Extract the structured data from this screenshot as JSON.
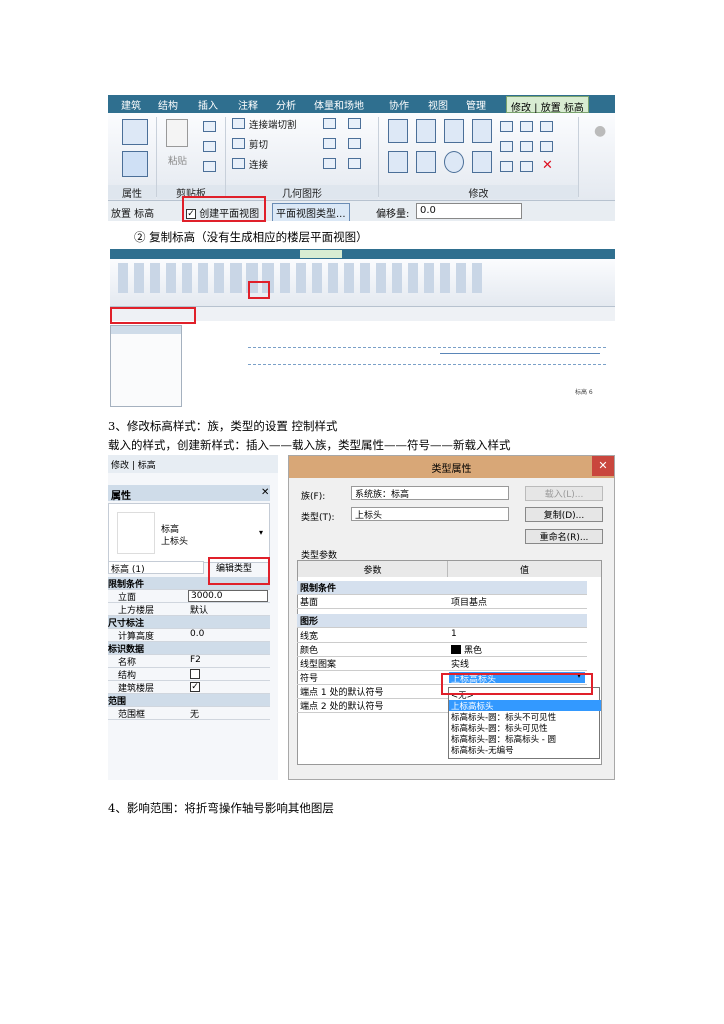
{
  "ribbon": {
    "tabs": [
      "建筑",
      "结构",
      "插入",
      "注释",
      "分析",
      "体量和场地",
      "协作",
      "视图",
      "管理"
    ],
    "active_tab": "修改 | 放置 标高",
    "buttons": {
      "cut_join": "连接端切割",
      "cut": "剪切",
      "join": "连接",
      "paste": "粘贴"
    },
    "groups": [
      "属性",
      "剪贴板",
      "几何图形",
      "修改"
    ]
  },
  "options_bar": {
    "context": "放置 标高",
    "create_plan_view_label": "创建平面视图",
    "create_plan_view_checked": true,
    "plan_view_types_button": "平面视图类型...",
    "offset_label": "偏移量:",
    "offset_value": "0.0"
  },
  "step2_caption": "② 复制标高（没有生成相应的楼层平面视图）",
  "shot2": {
    "level_marker": "标高 6"
  },
  "para3_title": "3、修改标高样式：族，类型的设置 控制样式",
  "para3_body": "载入的样式，创建新样式：插入——载入族，类型属性——符号——新载入样式",
  "properties_panel": {
    "context": "修改 | 标高",
    "title": "属性",
    "type_name": "标高",
    "type_sub": "上标头",
    "selector": "标高 (1)",
    "edit_type": "编辑类型",
    "sections": [
      {
        "name": "限制条件",
        "rows": [
          {
            "label": "立面",
            "value": "3000.0"
          },
          {
            "label": "上方楼层",
            "value": "默认"
          }
        ]
      },
      {
        "name": "尺寸标注",
        "rows": [
          {
            "label": "计算高度",
            "value": "0.0"
          }
        ]
      },
      {
        "name": "标识数据",
        "rows": [
          {
            "label": "名称",
            "value": "F2"
          },
          {
            "label": "结构",
            "value": ""
          },
          {
            "label": "建筑楼层",
            "value": "✓"
          }
        ]
      },
      {
        "name": "范围",
        "rows": [
          {
            "label": "范围框",
            "value": "无"
          }
        ]
      }
    ]
  },
  "type_dialog": {
    "title": "类型属性",
    "family_label": "族(F):",
    "family_value": "系统族：标高",
    "load_button": "载入(L)...",
    "type_label": "类型(T):",
    "type_value": "上标头",
    "duplicate_button": "复制(D)...",
    "rename_button": "重命名(R)...",
    "params_label": "类型参数",
    "col_param": "参数",
    "col_value": "值",
    "sections": [
      {
        "name": "限制条件",
        "rows": [
          {
            "label": "基面",
            "value": "项目基点"
          }
        ]
      },
      {
        "name": "图形",
        "rows": [
          {
            "label": "线宽",
            "value": "1"
          },
          {
            "label": "颜色",
            "value": "黑色"
          },
          {
            "label": "线型图案",
            "value": "实线"
          },
          {
            "label": "符号",
            "value": "上标高标头"
          },
          {
            "label": "端点 1 处的默认符号",
            "value": ""
          },
          {
            "label": "端点 2 处的默认符号",
            "value": ""
          }
        ]
      }
    ],
    "dropdown_options": [
      "<无>",
      "上标高标头",
      "标高标头-圆：标头不可见性",
      "标高标头-圆：标头可见性",
      "标高标头-圆：标高标头 - 圆",
      "标高标头-无编号"
    ],
    "selected_option": "上标高标头"
  },
  "para4": "4、影响范围：将折弯操作轴号影响其他图层",
  "colors": {
    "ribbon_tab_bg": "#2f6f8f",
    "highlight_red": "#e0202a",
    "dialog_title_bg": "#d8a777",
    "dropdown_selected": "#3399ff"
  }
}
